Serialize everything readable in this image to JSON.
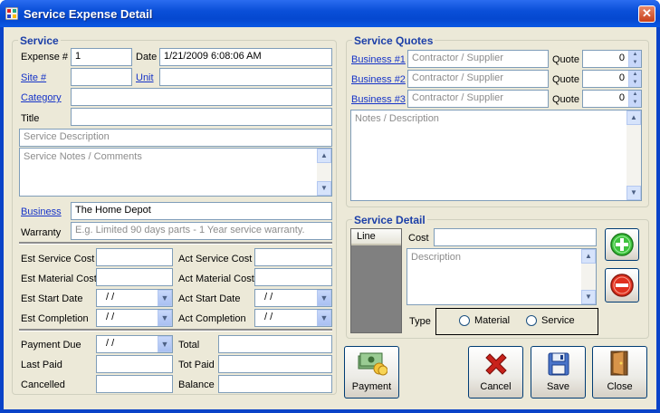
{
  "window": {
    "title": "Service Expense Detail",
    "close": "✕"
  },
  "service": {
    "group_title": "Service",
    "expense_label": "Expense #",
    "expense_value": "1",
    "date_label": "Date",
    "date_value": "1/21/2009 6:08:06 AM",
    "site_label": "Site #",
    "unit_label": "Unit",
    "category_label": "Category",
    "title_label": "Title",
    "description_placeholder": "Service Description",
    "notes_placeholder": "Service Notes / Comments",
    "business_label": "Business",
    "business_value": "The Home Depot",
    "warranty_label": "Warranty",
    "warranty_placeholder": "E.g. Limited 90 days parts - 1 Year service warranty.",
    "est_service_cost_label": "Est Service Cost",
    "act_service_cost_label": "Act Service Cost",
    "est_material_cost_label": "Est Material Cost",
    "act_material_cost_label": "Act Material Cost",
    "est_start_date_label": "Est Start Date",
    "act_start_date_label": "Act Start Date",
    "est_completion_label": "Est Completion",
    "act_completion_label": "Act Completion",
    "date_blank": "/ /",
    "payment_due_label": "Payment Due",
    "total_label": "Total",
    "last_paid_label": "Last Paid",
    "tot_paid_label": "Tot Paid",
    "cancelled_label": "Cancelled",
    "balance_label": "Balance"
  },
  "quotes": {
    "group_title": "Service Quotes",
    "rows": [
      {
        "label": "Business #1",
        "placeholder": "Contractor / Supplier",
        "quote_label": "Quote",
        "value": "0"
      },
      {
        "label": "Business #2",
        "placeholder": "Contractor / Supplier",
        "quote_label": "Quote",
        "value": "0"
      },
      {
        "label": "Business #3",
        "placeholder": "Contractor / Supplier",
        "quote_label": "Quote",
        "value": "0"
      }
    ],
    "notes_placeholder": "Notes / Description"
  },
  "detail": {
    "group_title": "Service Detail",
    "line_header": "Line",
    "cost_label": "Cost",
    "description_placeholder": "Description",
    "type_label": "Type",
    "material_label": "Material",
    "service_label": "Service"
  },
  "buttons": {
    "payment": "Payment",
    "cancel": "Cancel",
    "save": "Save",
    "close": "Close"
  }
}
